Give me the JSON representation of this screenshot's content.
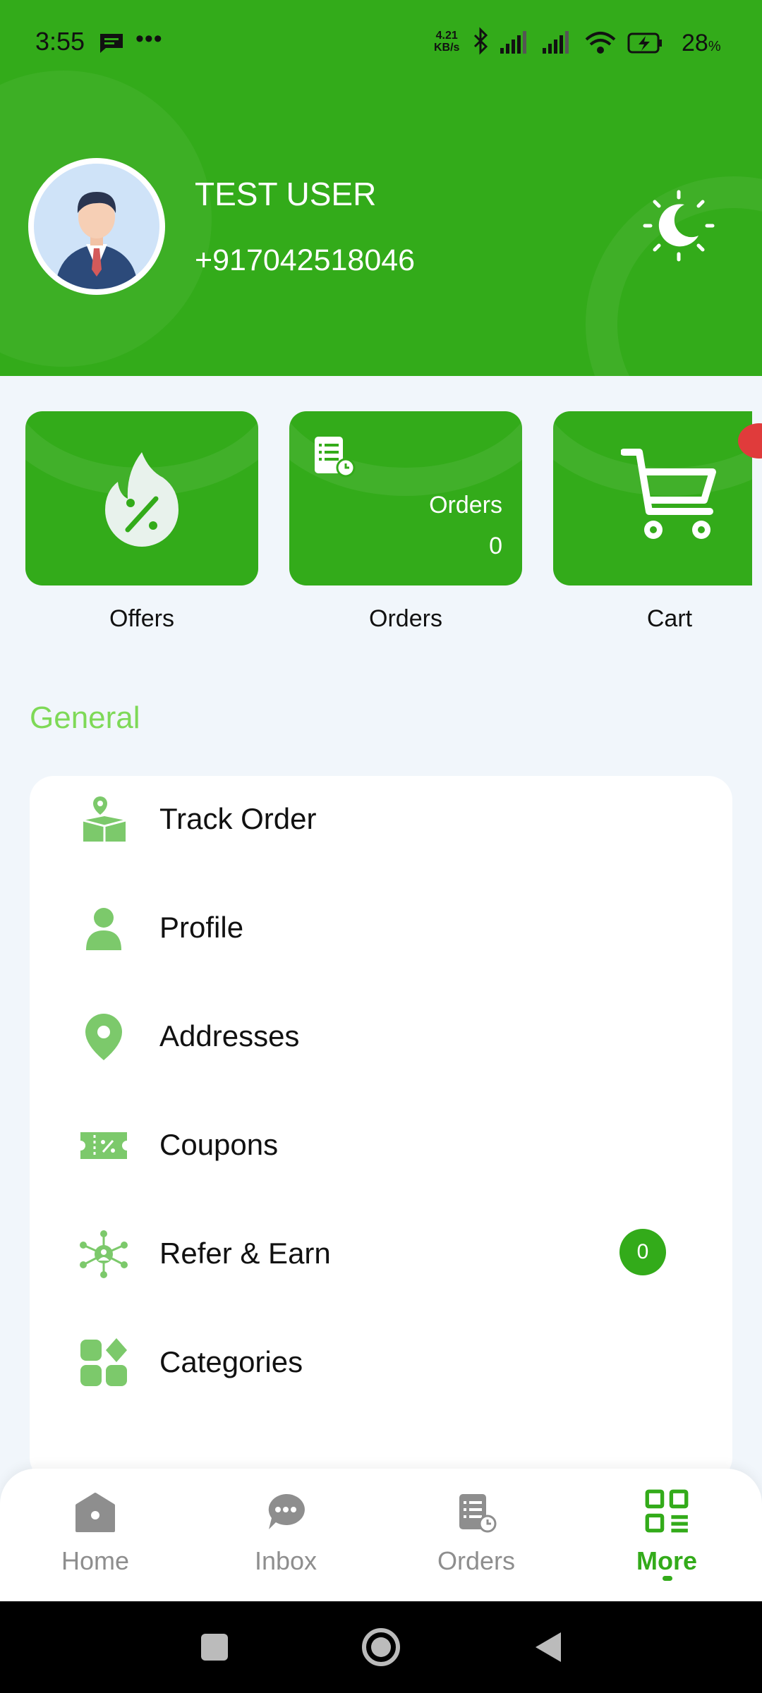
{
  "status_bar": {
    "time": "3:55",
    "net_speed_value": "4.21",
    "net_speed_unit": "KB/s",
    "battery_percent": "28",
    "battery_percent_sign": "%"
  },
  "profile": {
    "name": "TEST USER",
    "phone": "+917042518046"
  },
  "quick_actions": [
    {
      "label": "Offers",
      "icon": "fire-percent-icon"
    },
    {
      "label": "Orders",
      "icon": "orders-list-icon",
      "inner_label": "Orders",
      "count": "0"
    },
    {
      "label": "Cart",
      "icon": "cart-icon"
    }
  ],
  "section": {
    "general_title": "General"
  },
  "menu": [
    {
      "label": "Track Order",
      "icon": "track-order-icon"
    },
    {
      "label": "Profile",
      "icon": "person-icon"
    },
    {
      "label": "Addresses",
      "icon": "location-pin-icon"
    },
    {
      "label": "Coupons",
      "icon": "coupon-icon"
    },
    {
      "label": "Refer & Earn",
      "icon": "network-icon",
      "badge": "0"
    },
    {
      "label": "Categories",
      "icon": "categories-icon"
    }
  ],
  "bottom_nav": [
    {
      "label": "Home",
      "icon": "home-icon",
      "active": false
    },
    {
      "label": "Inbox",
      "icon": "chat-icon",
      "active": false
    },
    {
      "label": "Orders",
      "icon": "orders-icon",
      "active": false
    },
    {
      "label": "More",
      "icon": "grid-more-icon",
      "active": true
    }
  ],
  "colors": {
    "brand_green": "#33AB1A",
    "section_title_green": "#7ED957",
    "icon_green": "#7CC96B",
    "background": "#F1F6FB",
    "badge_red": "#E03B3B"
  }
}
